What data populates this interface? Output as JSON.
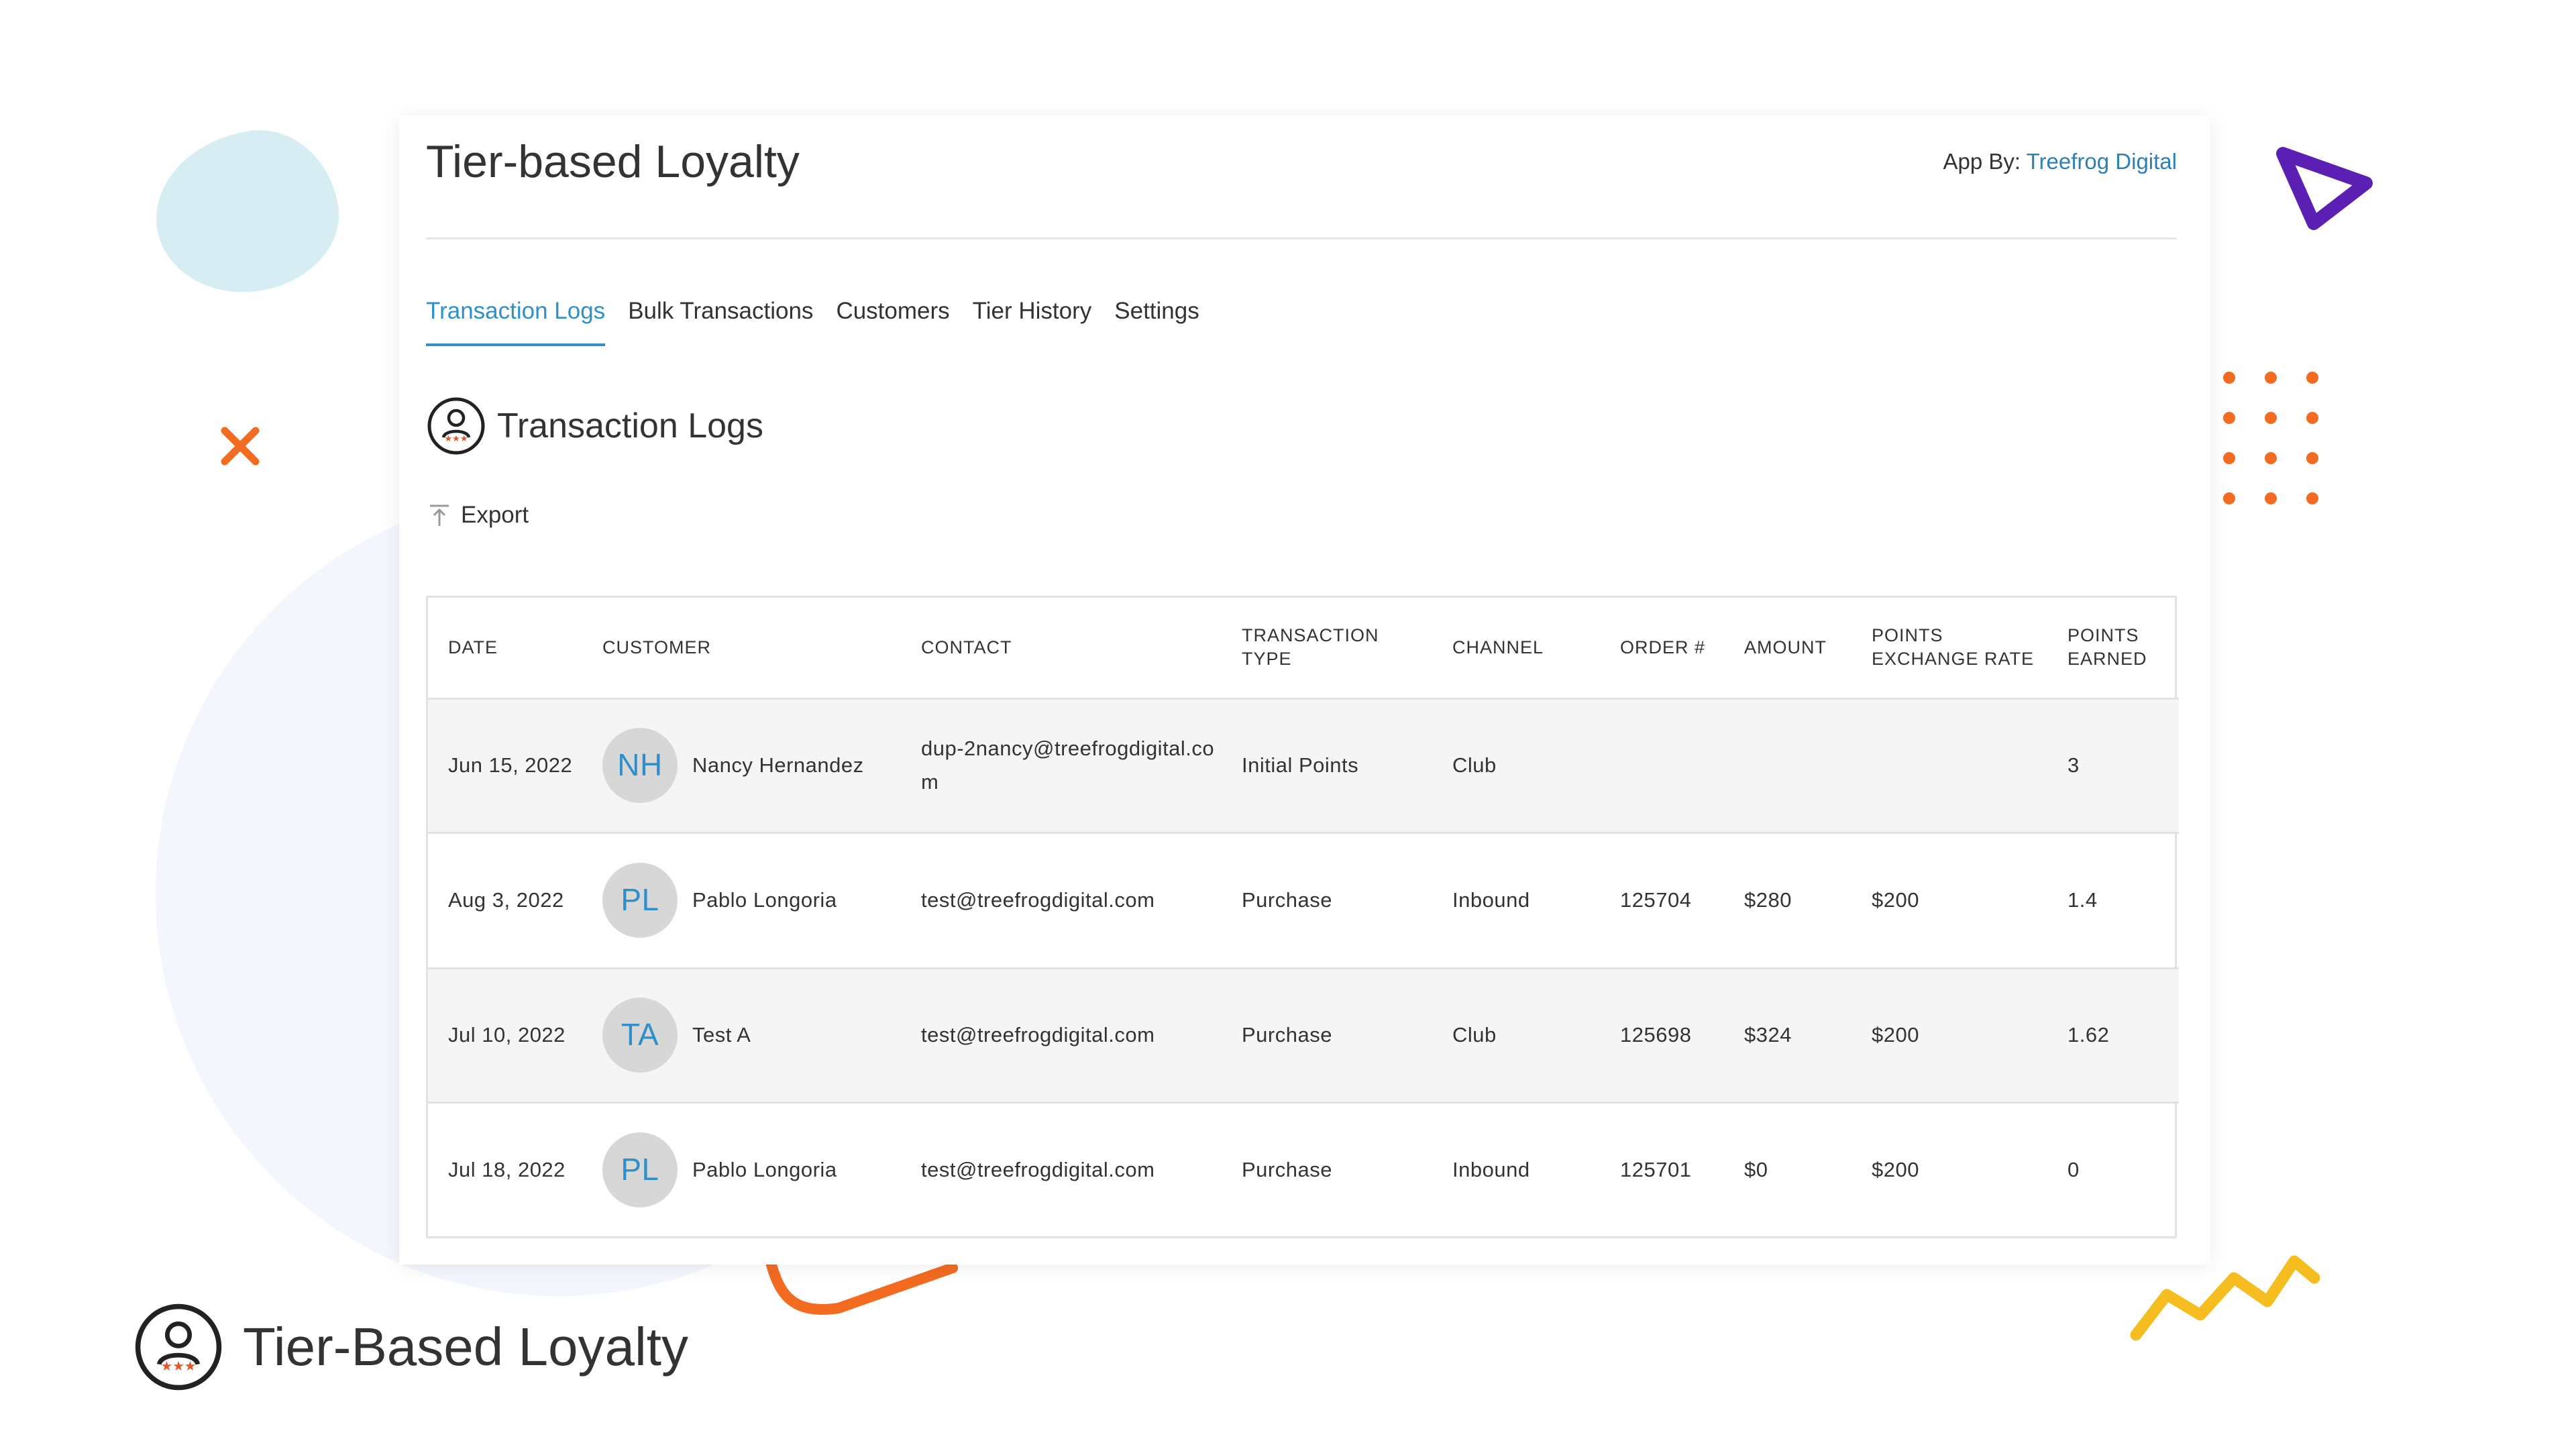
{
  "colors": {
    "accent": "#2f8fc9",
    "orange": "#f26b21",
    "purple": "#5b1fb3",
    "yellow": "#f5bd1f",
    "star": "#e2572b"
  },
  "app": {
    "title": "Tier-based Loyalty",
    "by_label": "App By:",
    "by_link": "Treefrog Digital"
  },
  "tabs": [
    {
      "label": "Transaction Logs",
      "active": true
    },
    {
      "label": "Bulk Transactions",
      "active": false
    },
    {
      "label": "Customers",
      "active": false
    },
    {
      "label": "Tier History",
      "active": false
    },
    {
      "label": "Settings",
      "active": false
    }
  ],
  "section": {
    "title": "Transaction Logs",
    "icon": "loyalty-user-stars-icon"
  },
  "export": {
    "label": "Export",
    "icon": "export-icon"
  },
  "table": {
    "columns": {
      "date": "DATE",
      "customer": "CUSTOMER",
      "contact": "CONTACT",
      "transaction_type": "TRANSACTION TYPE",
      "channel": "CHANNEL",
      "order": "ORDER #",
      "amount": "AMOUNT",
      "rate": "POINTS EXCHANGE RATE",
      "points": "POINTS EARNED"
    },
    "rows": [
      {
        "date": "Jun 15, 2022",
        "initials": "NH",
        "customer": "Nancy Hernandez",
        "contact": "dup-2nancy@treefrogdigital.com",
        "type": "Initial Points",
        "channel": "Club",
        "order": "",
        "amount": "",
        "rate": "",
        "points": "3"
      },
      {
        "date": "Aug 3, 2022",
        "initials": "PL",
        "customer": "Pablo Longoria",
        "contact": "test@treefrogdigital.com",
        "type": "Purchase",
        "channel": "Inbound",
        "order": "125704",
        "amount": "$280",
        "rate": "$200",
        "points": "1.4"
      },
      {
        "date": "Jul 10, 2022",
        "initials": "TA",
        "customer": "Test A",
        "contact": "test@treefrogdigital.com",
        "type": "Purchase",
        "channel": "Club",
        "order": "125698",
        "amount": "$324",
        "rate": "$200",
        "points": "1.62"
      },
      {
        "date": "Jul 18, 2022",
        "initials": "PL",
        "customer": "Pablo Longoria",
        "contact": "test@treefrogdigital.com",
        "type": "Purchase",
        "channel": "Inbound",
        "order": "125701",
        "amount": "$0",
        "rate": "$200",
        "points": "0"
      }
    ]
  },
  "footer": {
    "title": "Tier-Based Loyalty",
    "icon": "loyalty-user-stars-icon"
  }
}
